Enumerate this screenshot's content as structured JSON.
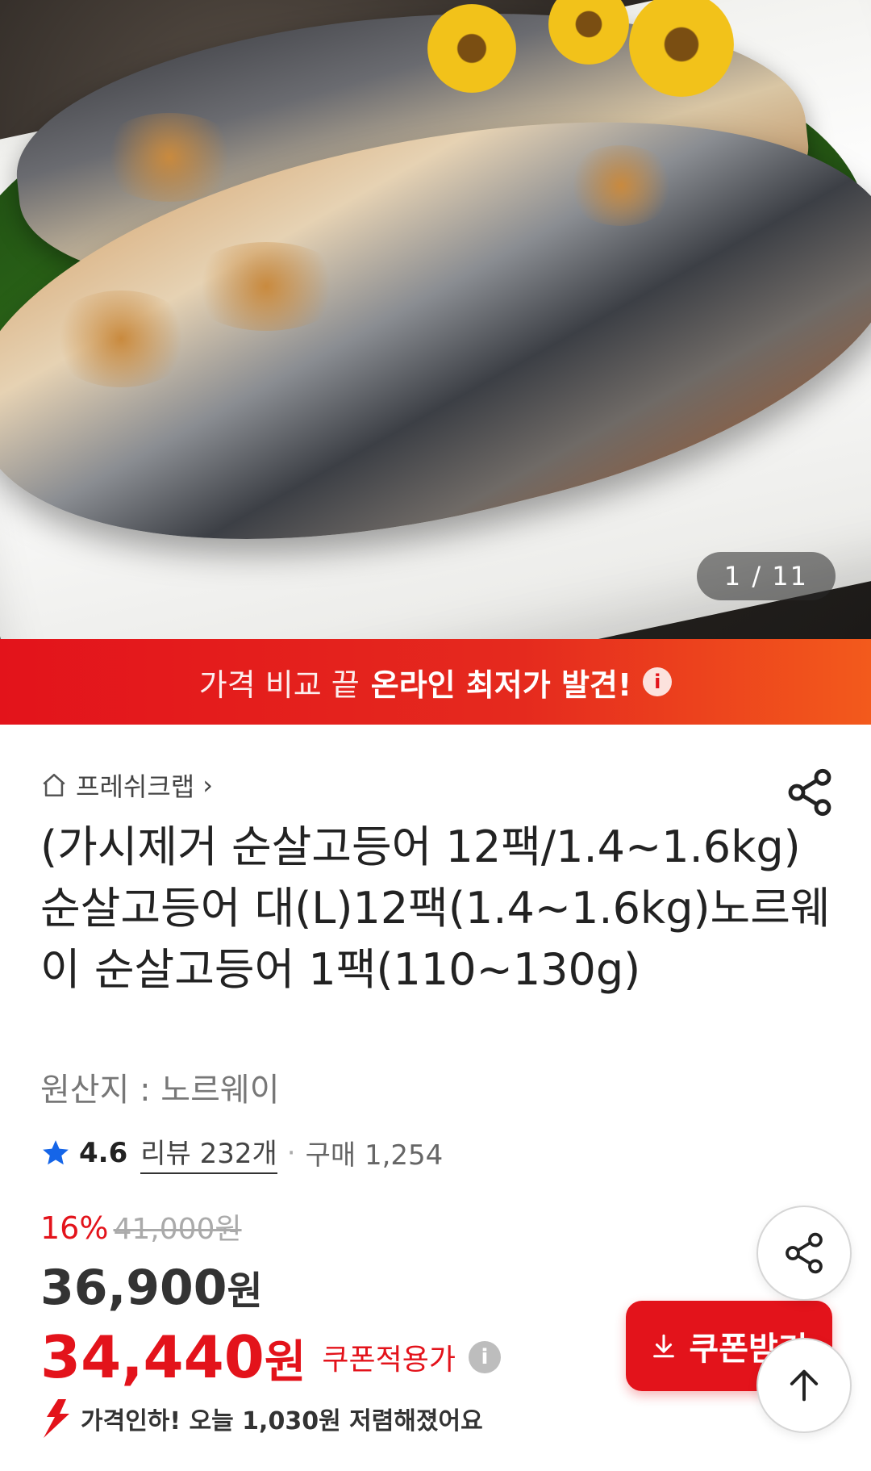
{
  "hero": {
    "counter": "1 / 11"
  },
  "banner": {
    "text_normal": "가격 비교 끝",
    "text_strong": "온라인 최저가 발견!",
    "info_icon": "i"
  },
  "store": {
    "name": "프레쉬크랩",
    "chevron": "›"
  },
  "product": {
    "title": "(가시제거 순살고등어 12팩/1.4~1.6kg)순살고등어 대(L)12팩(1.4~1.6kg)노르웨이 순살고등어 1팩(110~130g)",
    "origin": "원산지 : 노르웨이"
  },
  "rating": {
    "score": "4.6",
    "reviews": "리뷰 232개",
    "separator": "·",
    "sales": "구매 1,254"
  },
  "price": {
    "discount_rate": "16%",
    "original": "41,000원",
    "sale_number": "36,900",
    "sale_unit": "원",
    "coupon_number": "34,440",
    "coupon_unit": "원",
    "coupon_label": "쿠폰적용가",
    "info_icon": "i"
  },
  "price_drop": {
    "text": "가격인하! 오늘 1,030원 저렴해졌어요"
  },
  "buttons": {
    "coupon": "쿠폰받기"
  },
  "colors": {
    "accent": "#e3131b",
    "banner_end": "#f35a1c"
  }
}
